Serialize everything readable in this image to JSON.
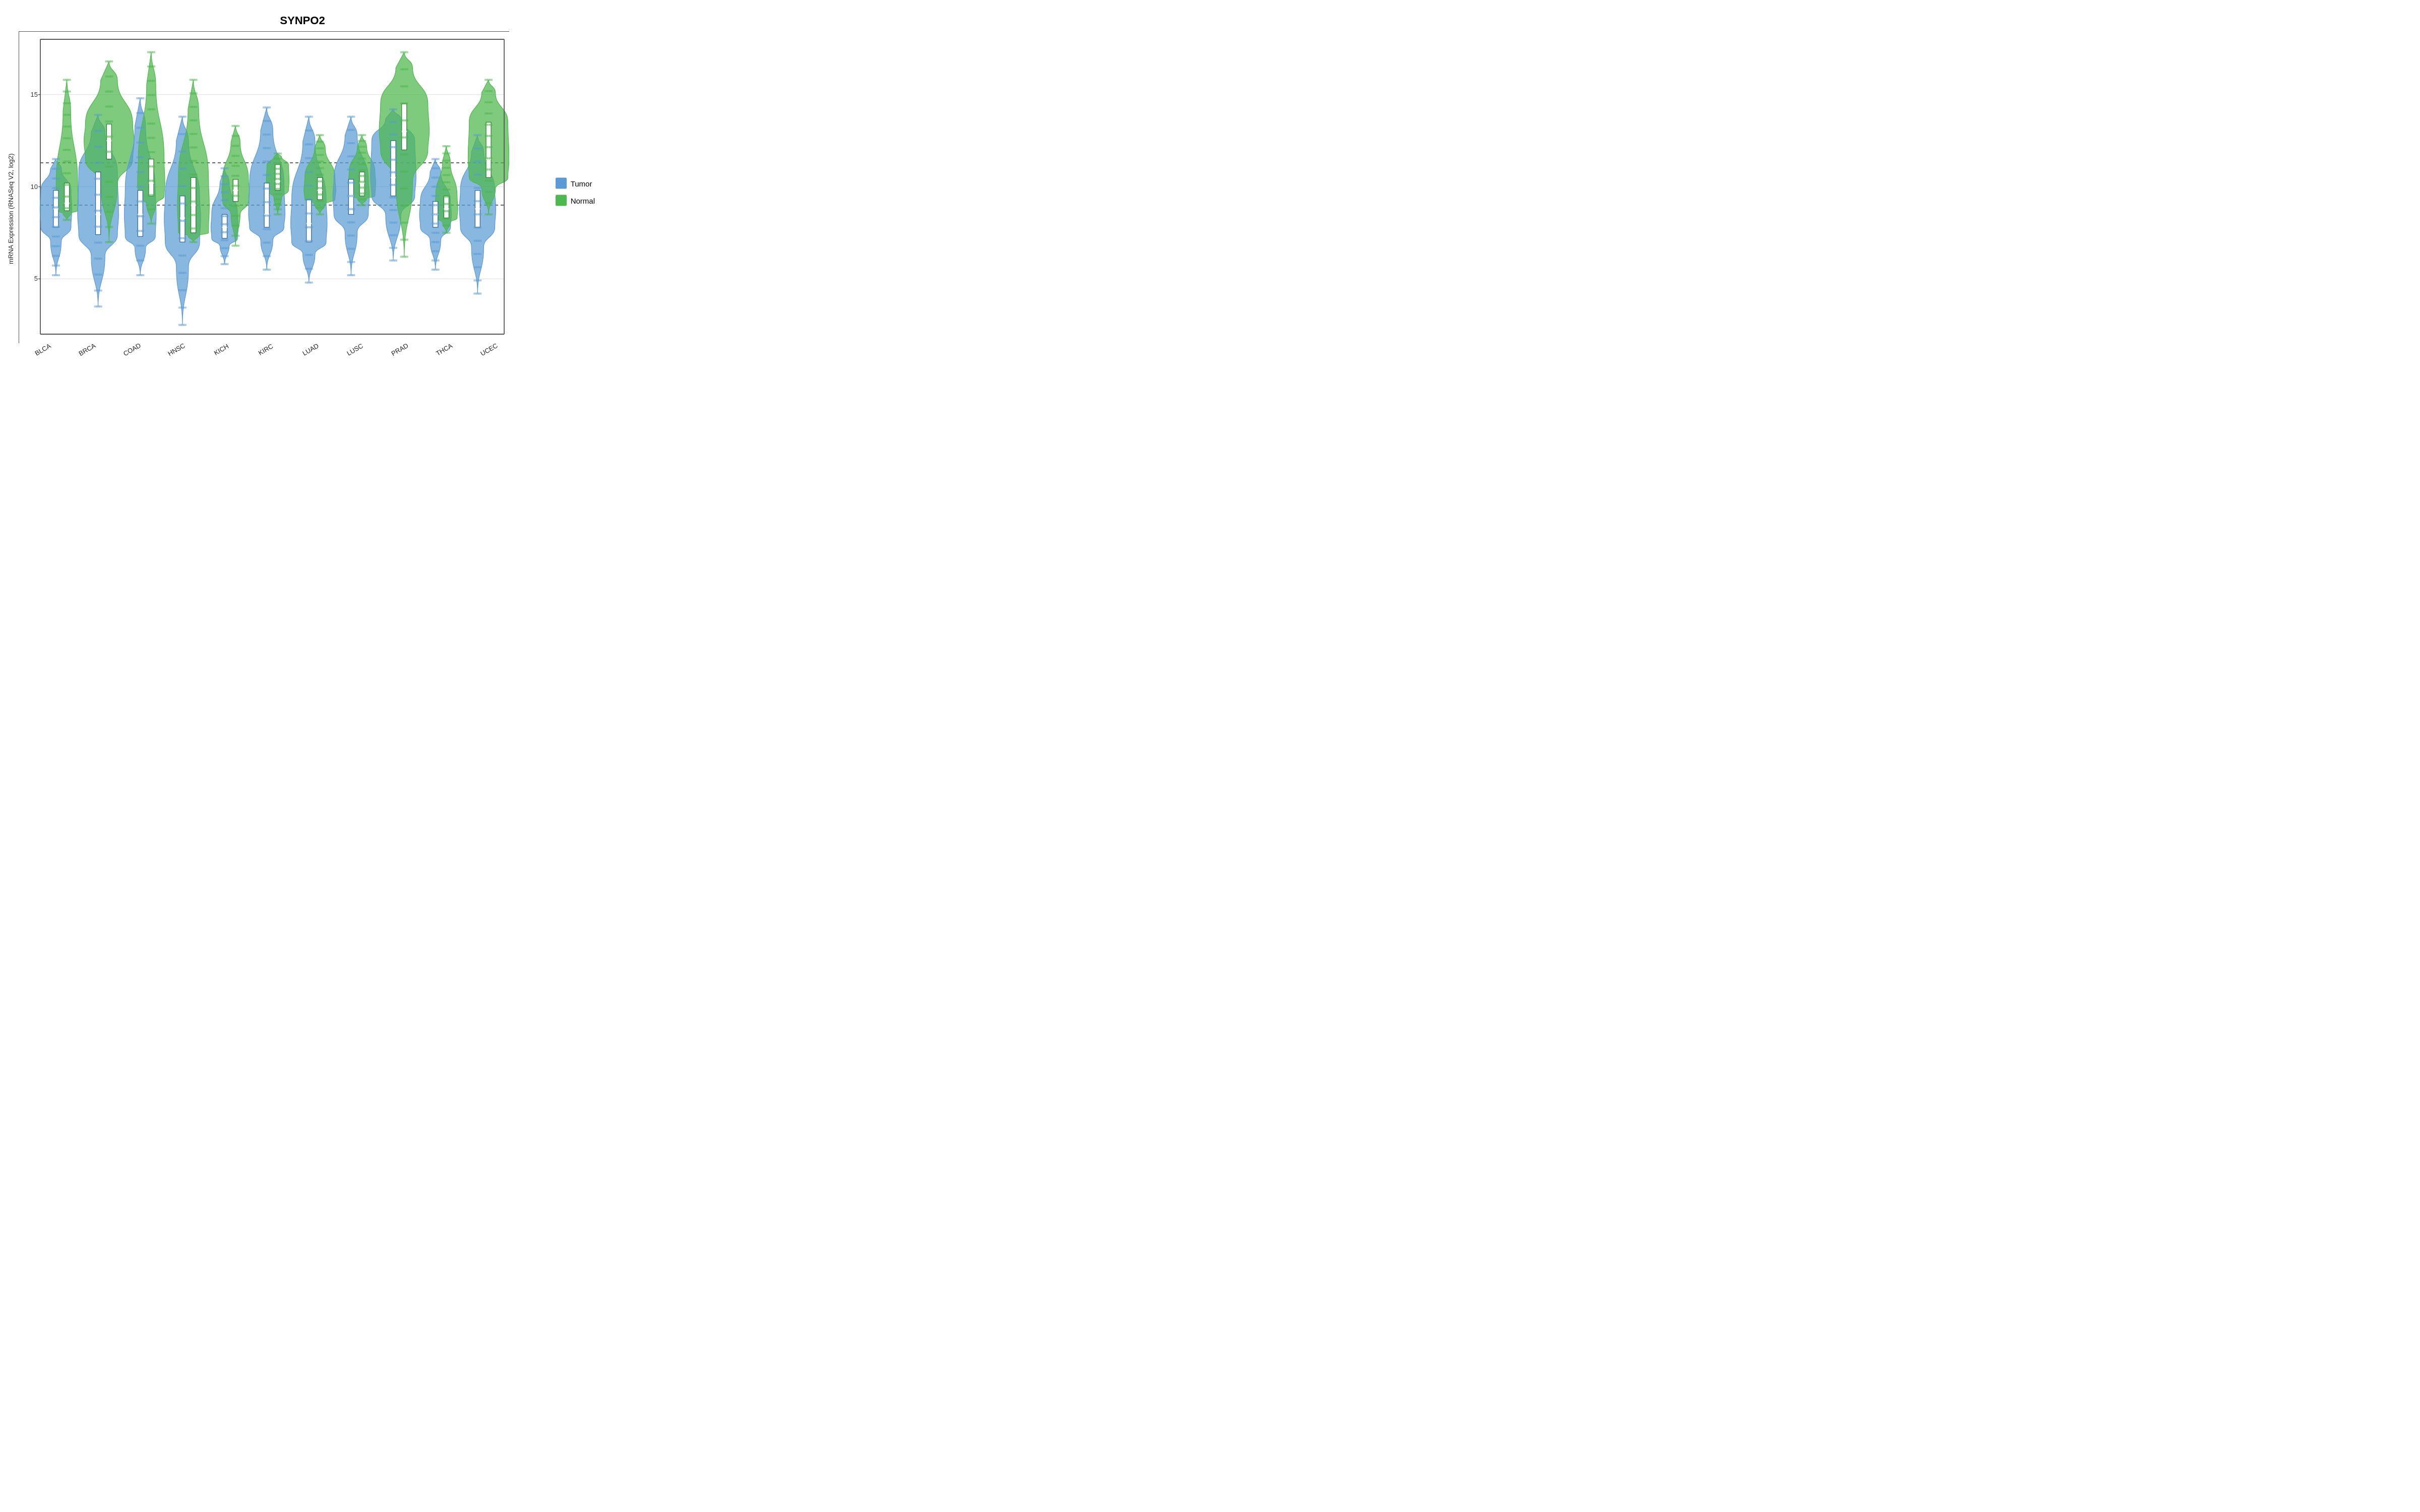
{
  "title": "SYNPO2",
  "yAxisLabel": "mRNA Expression (RNASeq V2, log2)",
  "yTicks": [
    5,
    10,
    15
  ],
  "yMin": 2,
  "yMax": 18,
  "dotted_lines": [
    9.0,
    11.3
  ],
  "xLabels": [
    "BLCA",
    "BRCA",
    "COAD",
    "HNSC",
    "KICH",
    "KIRC",
    "LUAD",
    "LUSC",
    "PRAD",
    "THCA",
    "UCEC"
  ],
  "legend": {
    "items": [
      {
        "label": "Tumor",
        "color": "#4d8fc9"
      },
      {
        "label": "Normal",
        "color": "#4caf50"
      }
    ]
  },
  "violins": [
    {
      "name": "BLCA",
      "tumor": {
        "center": 8.8,
        "q1": 7.8,
        "q3": 9.8,
        "min": 5.2,
        "max": 11.5,
        "width": 0.35
      },
      "normal": {
        "center": 9.1,
        "q1": 8.7,
        "q3": 10.2,
        "min": 8.2,
        "max": 15.8,
        "width": 0.25
      }
    },
    {
      "name": "BRCA",
      "tumor": {
        "center": 8.5,
        "q1": 7.4,
        "q3": 10.8,
        "min": 3.5,
        "max": 13.9,
        "width": 0.45
      },
      "normal": {
        "center": 12.5,
        "q1": 11.5,
        "q3": 13.4,
        "min": 7.0,
        "max": 16.8,
        "width": 0.55
      }
    },
    {
      "name": "COAD",
      "tumor": {
        "center": 8.5,
        "q1": 7.3,
        "q3": 9.8,
        "min": 5.2,
        "max": 14.8,
        "width": 0.35
      },
      "normal": {
        "center": 10.2,
        "q1": 9.5,
        "q3": 11.5,
        "min": 8.0,
        "max": 17.3,
        "width": 0.3
      }
    },
    {
      "name": "HNSC",
      "tumor": {
        "center": 8.3,
        "q1": 7.0,
        "q3": 9.5,
        "min": 2.5,
        "max": 13.8,
        "width": 0.4
      },
      "normal": {
        "center": 9.0,
        "q1": 7.5,
        "q3": 10.5,
        "min": 7.0,
        "max": 15.8,
        "width": 0.35
      }
    },
    {
      "name": "KICH",
      "tumor": {
        "center": 7.8,
        "q1": 7.2,
        "q3": 8.5,
        "min": 5.8,
        "max": 11.0,
        "width": 0.3
      },
      "normal": {
        "center": 9.8,
        "q1": 9.2,
        "q3": 10.4,
        "min": 6.8,
        "max": 13.3,
        "width": 0.3
      }
    },
    {
      "name": "KIRC",
      "tumor": {
        "center": 8.5,
        "q1": 7.8,
        "q3": 10.2,
        "min": 5.5,
        "max": 14.3,
        "width": 0.4
      },
      "normal": {
        "center": 10.3,
        "q1": 9.8,
        "q3": 11.2,
        "min": 8.5,
        "max": 11.8,
        "width": 0.25
      }
    },
    {
      "name": "LUAD",
      "tumor": {
        "center": 8.0,
        "q1": 7.0,
        "q3": 9.3,
        "min": 4.8,
        "max": 13.8,
        "width": 0.4
      },
      "normal": {
        "center": 9.8,
        "q1": 9.3,
        "q3": 10.5,
        "min": 8.5,
        "max": 12.8,
        "width": 0.35
      }
    },
    {
      "name": "LUSC",
      "tumor": {
        "center": 9.5,
        "q1": 8.5,
        "q3": 10.4,
        "min": 5.2,
        "max": 13.8,
        "width": 0.4
      },
      "normal": {
        "center": 10.2,
        "q1": 9.5,
        "q3": 10.8,
        "min": 9.0,
        "max": 12.8,
        "width": 0.3
      }
    },
    {
      "name": "PRAD",
      "tumor": {
        "center": 10.5,
        "q1": 9.5,
        "q3": 12.5,
        "min": 6.0,
        "max": 14.2,
        "width": 0.5
      },
      "normal": {
        "center": 13.0,
        "q1": 12.0,
        "q3": 14.5,
        "min": 6.2,
        "max": 17.3,
        "width": 0.55
      }
    },
    {
      "name": "THCA",
      "tumor": {
        "center": 8.5,
        "q1": 7.8,
        "q3": 9.2,
        "min": 5.5,
        "max": 11.5,
        "width": 0.35
      },
      "normal": {
        "center": 8.8,
        "q1": 8.3,
        "q3": 9.5,
        "min": 7.5,
        "max": 12.2,
        "width": 0.25
      }
    },
    {
      "name": "UCEC",
      "tumor": {
        "center": 8.8,
        "q1": 7.8,
        "q3": 9.8,
        "min": 4.2,
        "max": 12.8,
        "width": 0.4
      },
      "normal": {
        "center": 11.5,
        "q1": 10.5,
        "q3": 13.5,
        "min": 8.5,
        "max": 15.8,
        "width": 0.45
      }
    }
  ],
  "colors": {
    "tumor": "#5b9bd5",
    "normal": "#4db84d",
    "tumorDark": "#2a6496",
    "normalDark": "#2d7a2d",
    "dotLine": "#333",
    "axis": "#555",
    "background": "#fff"
  }
}
